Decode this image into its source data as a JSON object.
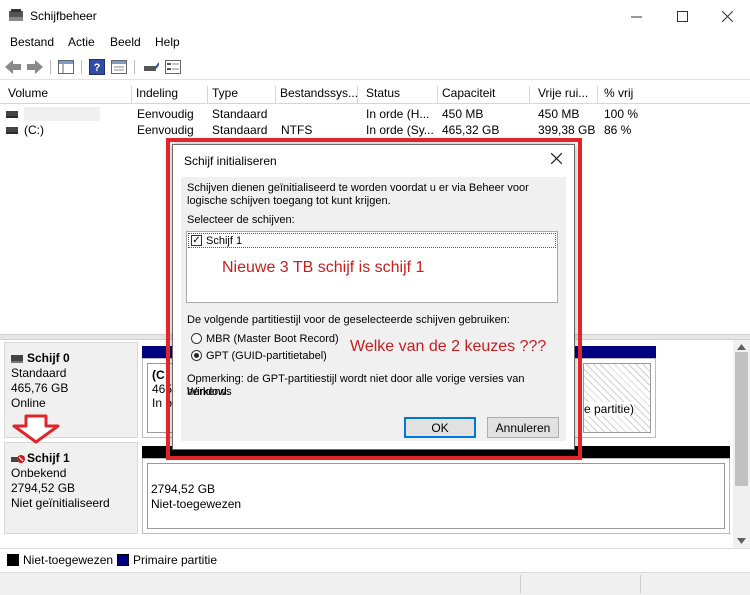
{
  "window": {
    "title": "Schijfbeheer",
    "minimize_icon": "minimize-icon",
    "maximize_icon": "maximize-icon",
    "close_icon": "close-icon"
  },
  "menu": {
    "items": [
      "Bestand",
      "Actie",
      "Beeld",
      "Help"
    ]
  },
  "volume_table": {
    "columns": [
      "Volume",
      "Indeling",
      "Type",
      "Bestandssys...",
      "Status",
      "Capaciteit",
      "Vrije rui...",
      "% vrij"
    ],
    "rows": [
      [
        "",
        "Eenvoudig",
        "Standaard",
        "",
        "In orde (H...",
        "450 MB",
        "450 MB",
        "100 %"
      ],
      [
        "(C:)",
        "Eenvoudig",
        "Standaard",
        "NTFS",
        "In orde (Sy...",
        "465,32 GB",
        "399,38 GB",
        "86 %"
      ]
    ]
  },
  "disks": [
    {
      "name": "Schijf 0",
      "type": "Standaard",
      "size": "465,76 GB",
      "status": "Online",
      "partitions": {
        "left_label": "(C",
        "left_size": "465,3",
        "left_status": "In o",
        "right_text": "e partitie)"
      }
    },
    {
      "name": "Schijf 1",
      "type": "Onbekend",
      "size": "2794,52 GB",
      "status": "Niet geïnitialiseerd",
      "unallocated_size": "2794,52 GB",
      "unallocated_label": "Niet-toegewezen"
    }
  ],
  "legend": {
    "unallocated": "Niet-toegewezen",
    "primary": "Primaire partitie",
    "unallocated_color": "#000000",
    "primary_color": "#000080"
  },
  "dialog": {
    "title": "Schijf initialiseren",
    "intro_line1": "Schijven dienen geïnitialiseerd te worden voordat u er via Beheer voor",
    "intro_line2": "logische schijven toegang tot kunt krijgen.",
    "select_label": "Selecteer de schijven:",
    "disk_item": "Schijf 1",
    "partition_label": "De volgende partitiestijl voor de geselecteerde schijven gebruiken:",
    "option_mbr": "MBR (Master Boot Record)",
    "option_gpt": "GPT (GUID-partitietabel)",
    "selected_option": "GPT",
    "note_line1": "Opmerking: de GPT-partitiestijl wordt niet door alle vorige versies van Windows",
    "note_line2": "herkend.",
    "ok_label": "OK",
    "cancel_label": "Annuleren"
  },
  "annotations": {
    "disk_note": "Nieuwe 3 TB schijf is schijf 1",
    "question": "Welke van de 2 keuzes ???",
    "color": "#e0262a"
  },
  "colors": {
    "primary_partition_bar": "#000080",
    "unallocated_bar": "#000000",
    "default_button_border": "#0078d7"
  }
}
